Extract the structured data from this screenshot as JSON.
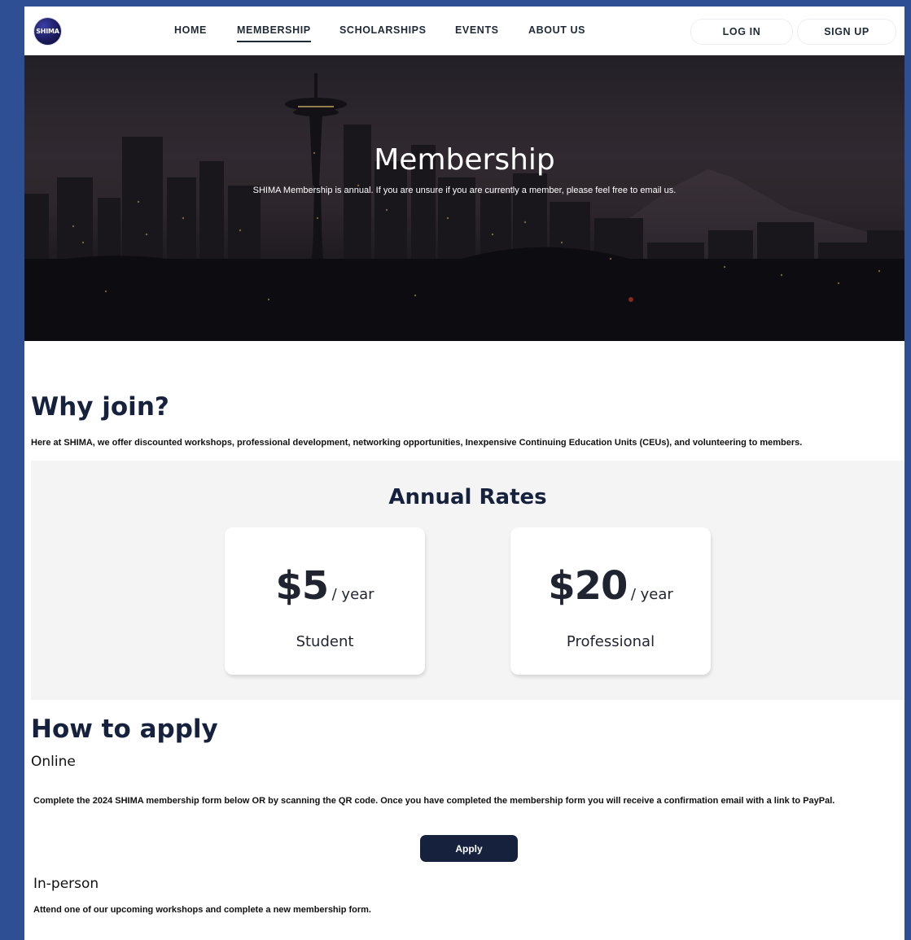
{
  "nav": {
    "logo_text": "SHIMA",
    "links": [
      "HOME",
      "MEMBERSHIP",
      "SCHOLARSHIPS",
      "EVENTS",
      "ABOUT US"
    ],
    "active": "MEMBERSHIP",
    "login": "LOG IN",
    "signup": "SIGN UP"
  },
  "hero": {
    "title": "Membership",
    "subtitle": "SHIMA Membership is annual. If you are unsure if you are currently a member, please feel free to email us."
  },
  "why": {
    "title": "Why join?",
    "text": "Here at SHIMA, we offer discounted workshops, professional development, networking opportunities, Inexpensive Continuing Education Units (CEUs), and volunteering to members."
  },
  "rates": {
    "title": "Annual Rates",
    "cards": [
      {
        "amount": "$5",
        "per": "/ year",
        "label": "Student"
      },
      {
        "amount": "$20",
        "per": "/ year",
        "label": "Professional"
      }
    ]
  },
  "apply": {
    "title": "How to apply",
    "online_label": "Online",
    "online_text_part1": "Complete the 2024 SHIMA membership form below ",
    "online_text_bold": "OR",
    "online_text_part2": " by scanning the QR code. Once you have completed the membership form you will receive a confirmation email with a link to PayPal.",
    "button": "Apply",
    "inperson_label": "In-person",
    "inperson_text": "Attend one of our upcoming workshops and complete a new membership form."
  },
  "colors": {
    "frame": "#2f4f95",
    "navy": "#16213d",
    "rates_bg": "#f4f4f5"
  },
  "icons": {
    "logo": "shima-logo-circle"
  }
}
